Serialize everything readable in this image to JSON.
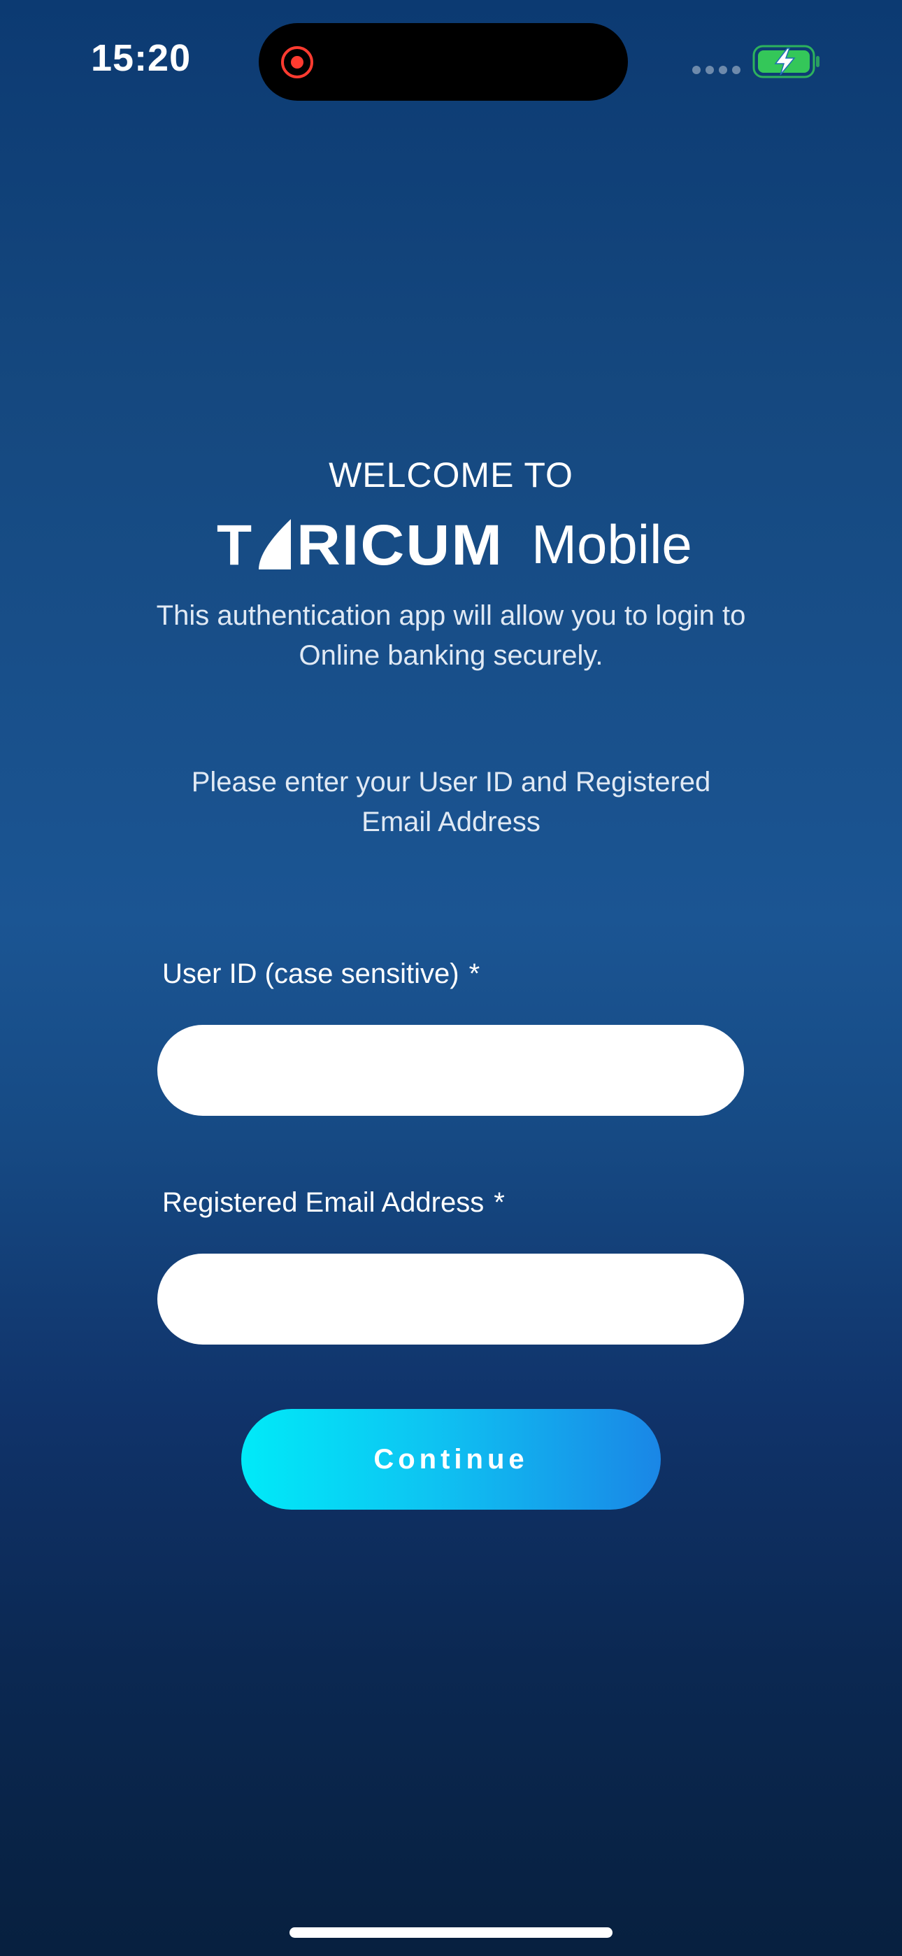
{
  "status_bar": {
    "time": "15:20",
    "icons": [
      "screen-recording-icon",
      "signal-dots-icon",
      "battery-charging-icon"
    ],
    "battery_color": "#34c759",
    "record_color": "#ff3b30"
  },
  "welcome": {
    "heading": "WELCOME TO",
    "brand_name": "TARICUM",
    "brand_suffix": "Mobile",
    "intro": "This authentication app will allow you to login to Online banking securely.",
    "instruction": "Please enter your User ID and Registered Email Address"
  },
  "form": {
    "user_id": {
      "label": "User ID (case sensitive)",
      "required_mark": "*",
      "value": "",
      "placeholder": ""
    },
    "email": {
      "label": "Registered Email Address",
      "required_mark": "*",
      "value": "",
      "placeholder": ""
    },
    "continue_label": "Continue"
  },
  "theme": {
    "background_top": "#0c3a72",
    "background_mid": "#1b5593",
    "background_bottom": "#07203f",
    "button_gradient_start": "#00eaf8",
    "button_gradient_end": "#1a86e6",
    "input_background": "#ffffff"
  }
}
